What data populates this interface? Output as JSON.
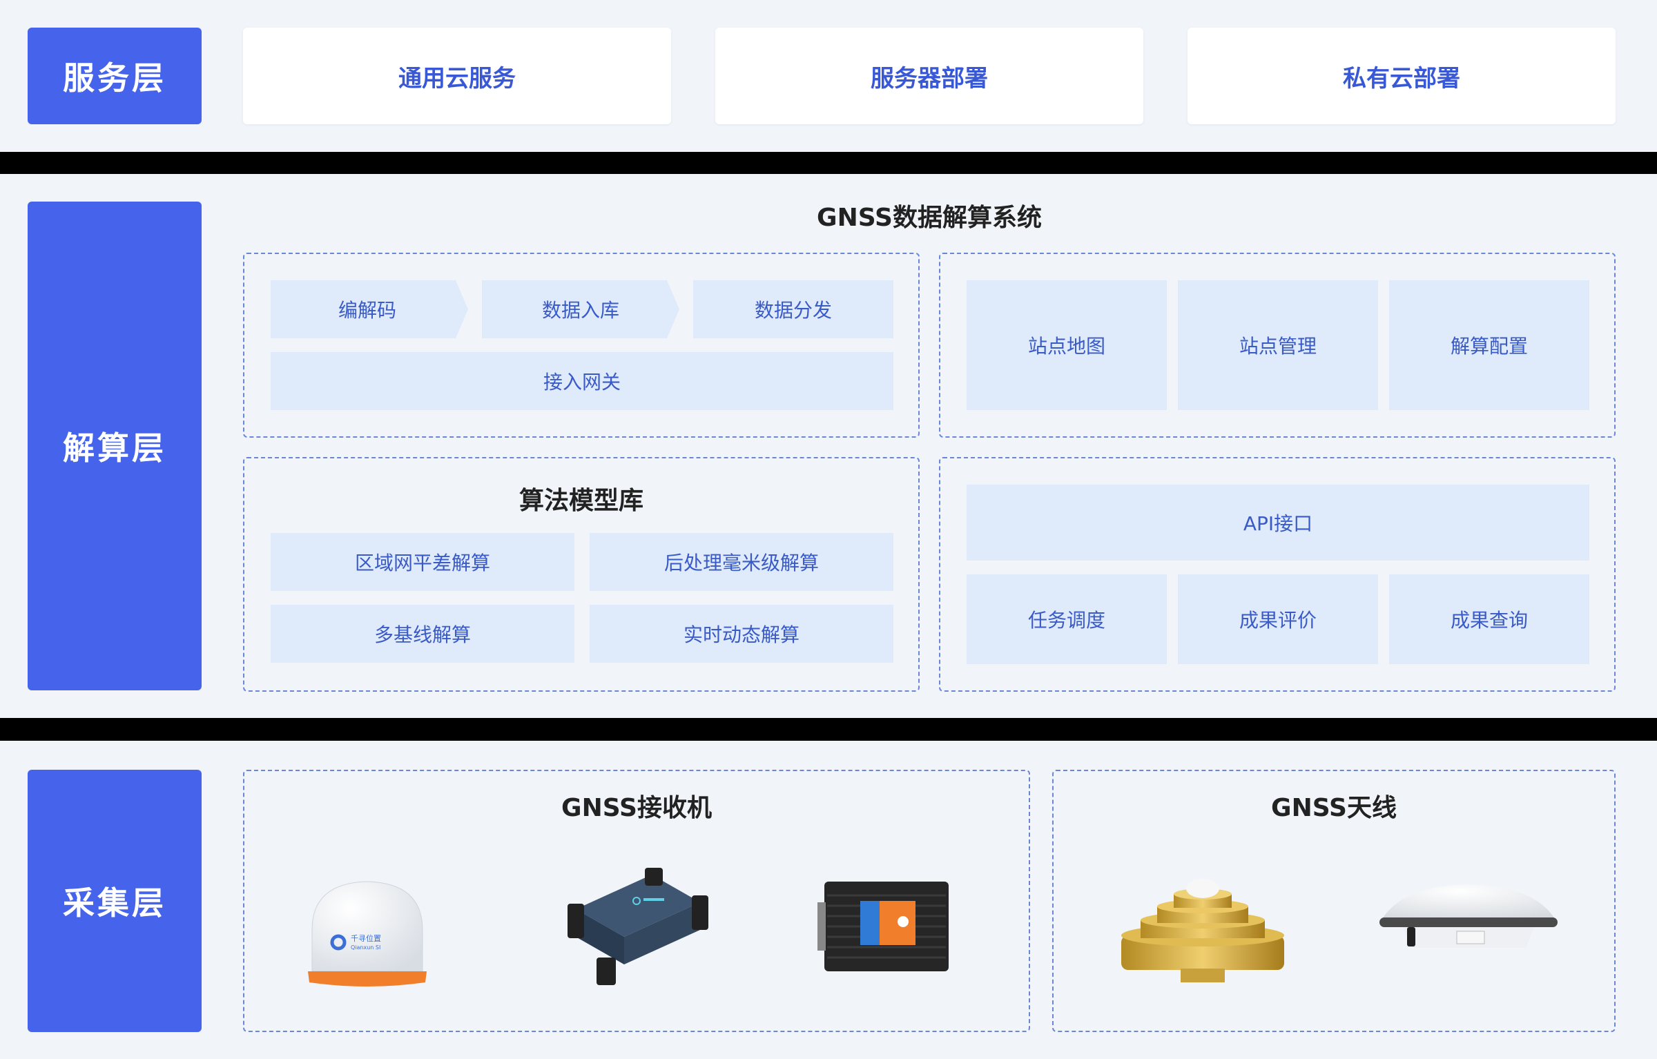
{
  "layers": {
    "service": "服务层",
    "solve": "解算层",
    "collect": "采集层"
  },
  "service": {
    "cards": [
      "通用云服务",
      "服务器部署",
      "私有云部署"
    ]
  },
  "solve": {
    "title": "GNSS数据解算系统",
    "pipeline": [
      "编解码",
      "数据入库",
      "数据分发"
    ],
    "gateway": "接入网关",
    "station": [
      "站点地图",
      "站点管理",
      "解算配置"
    ],
    "algo_title": "算法模型库",
    "algo": [
      "区域网平差解算",
      "后处理毫米级解算",
      "多基线解算",
      "实时动态解算"
    ],
    "api": "API接口",
    "tasks": [
      "任务调度",
      "成果评价",
      "成果查询"
    ]
  },
  "collect": {
    "receiver_title": "GNSS接收机",
    "antenna_title": "GNSS天线",
    "dome_brand": "千寻位置",
    "dome_brand_en": "Qianxun SI"
  },
  "colors": {
    "label_bg": "#4664eb",
    "cell_bg": "#dfeafb",
    "cell_text": "#3a5bc6",
    "band_bg": "#f1f5f9",
    "dashed": "#6b86d8"
  }
}
